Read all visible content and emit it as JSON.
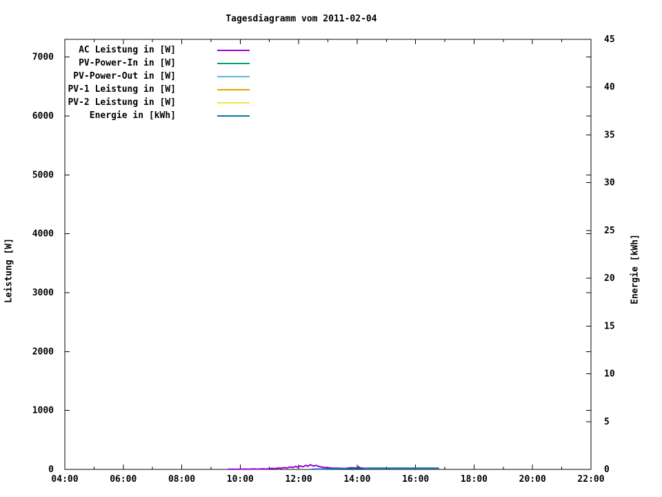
{
  "chart_data": {
    "type": "line",
    "title": "Tagesdiagramm vom 2011-02-04",
    "grid": false,
    "legend_position": "top-left-inside",
    "x_axis": {
      "label": "",
      "unit": "time",
      "range": [
        4,
        22
      ],
      "major_ticks": [
        {
          "value": 4,
          "label": "04:00"
        },
        {
          "value": 6,
          "label": "06:00"
        },
        {
          "value": 8,
          "label": "08:00"
        },
        {
          "value": 10,
          "label": "10:00"
        },
        {
          "value": 12,
          "label": "12:00"
        },
        {
          "value": 14,
          "label": "14:00"
        },
        {
          "value": 16,
          "label": "16:00"
        },
        {
          "value": 18,
          "label": "18:00"
        },
        {
          "value": 20,
          "label": "20:00"
        },
        {
          "value": 22,
          "label": "22:00"
        }
      ],
      "minor_tick_values": [
        5,
        7,
        9,
        11,
        13,
        15,
        17,
        19,
        21
      ]
    },
    "y_left": {
      "label": "Leistung [W]",
      "range": [
        0,
        7300
      ],
      "major_ticks": [
        {
          "value": 0,
          "label": "0"
        },
        {
          "value": 1000,
          "label": "1000"
        },
        {
          "value": 2000,
          "label": "2000"
        },
        {
          "value": 3000,
          "label": "3000"
        },
        {
          "value": 4000,
          "label": "4000"
        },
        {
          "value": 5000,
          "label": "5000"
        },
        {
          "value": 6000,
          "label": "6000"
        },
        {
          "value": 7000,
          "label": "7000"
        }
      ]
    },
    "y_right": {
      "label": "Energie [kWh]",
      "range": [
        0,
        45
      ],
      "major_ticks": [
        {
          "value": 0,
          "label": "0"
        },
        {
          "value": 5,
          "label": "5"
        },
        {
          "value": 10,
          "label": "10"
        },
        {
          "value": 15,
          "label": "15"
        },
        {
          "value": 20,
          "label": "20"
        },
        {
          "value": 25,
          "label": "25"
        },
        {
          "value": 30,
          "label": "30"
        },
        {
          "value": 35,
          "label": "35"
        },
        {
          "value": 40,
          "label": "40"
        },
        {
          "value": 45,
          "label": "45"
        }
      ]
    },
    "legend": [
      {
        "label": "AC Leistung in [W]",
        "color": "#9400d3"
      },
      {
        "label": "PV-Power-In in [W]",
        "color": "#009e73"
      },
      {
        "label": "PV-Power-Out in [W]",
        "color": "#56b4e9"
      },
      {
        "label": "PV-1 Leistung in [W]",
        "color": "#e69f00"
      },
      {
        "label": "PV-2 Leistung in [W]",
        "color": "#f0e442"
      },
      {
        "label": "Energie in [kWh]",
        "color": "#0072b2"
      }
    ],
    "series": [
      {
        "name": "AC Leistung in [W]",
        "color": "#9400d3",
        "axis": "left",
        "points": [
          [
            9.57,
            2
          ],
          [
            9.7,
            4
          ],
          [
            9.85,
            2
          ],
          [
            10.0,
            3
          ],
          [
            10.15,
            6
          ],
          [
            10.3,
            3
          ],
          [
            10.45,
            8
          ],
          [
            10.6,
            5
          ],
          [
            10.75,
            10
          ],
          [
            10.9,
            7
          ],
          [
            11.0,
            12
          ],
          [
            11.1,
            18
          ],
          [
            11.2,
            12
          ],
          [
            11.3,
            25
          ],
          [
            11.4,
            18
          ],
          [
            11.5,
            32
          ],
          [
            11.6,
            24
          ],
          [
            11.7,
            42
          ],
          [
            11.8,
            30
          ],
          [
            11.9,
            52
          ],
          [
            11.95,
            38
          ],
          [
            12.05,
            58
          ],
          [
            12.15,
            45
          ],
          [
            12.25,
            70
          ],
          [
            12.3,
            52
          ],
          [
            12.4,
            78
          ],
          [
            12.5,
            58
          ],
          [
            12.6,
            68
          ],
          [
            12.7,
            48
          ],
          [
            12.8,
            40
          ],
          [
            12.9,
            32
          ],
          [
            13.0,
            28
          ],
          [
            13.15,
            22
          ],
          [
            13.3,
            20
          ],
          [
            13.45,
            18
          ],
          [
            13.6,
            15
          ],
          [
            13.75,
            28
          ],
          [
            13.9,
            26
          ],
          [
            14.0,
            24
          ],
          [
            14.05,
            46
          ],
          [
            14.1,
            26
          ],
          [
            14.2,
            20
          ],
          [
            14.3,
            6
          ],
          [
            14.4,
            2
          ]
        ]
      },
      {
        "name": "PV-Power-In in [W]",
        "color": "#009e73",
        "axis": "left",
        "points": []
      },
      {
        "name": "PV-Power-Out in [W]",
        "color": "#56b4e9",
        "axis": "left",
        "points": []
      },
      {
        "name": "PV-1 Leistung in [W]",
        "color": "#e69f00",
        "axis": "left",
        "points": []
      },
      {
        "name": "PV-2 Leistung in [W]",
        "color": "#f0e442",
        "axis": "left",
        "points": []
      },
      {
        "name": "Energie in [kWh]",
        "color": "#0072b2",
        "axis": "right",
        "points": [
          [
            12.45,
            0.02
          ],
          [
            13.0,
            0.06
          ],
          [
            13.5,
            0.09
          ],
          [
            14.0,
            0.11
          ],
          [
            14.5,
            0.12
          ],
          [
            15.0,
            0.13
          ],
          [
            15.5,
            0.13
          ],
          [
            16.0,
            0.13
          ],
          [
            16.8,
            0.13
          ]
        ]
      }
    ]
  }
}
